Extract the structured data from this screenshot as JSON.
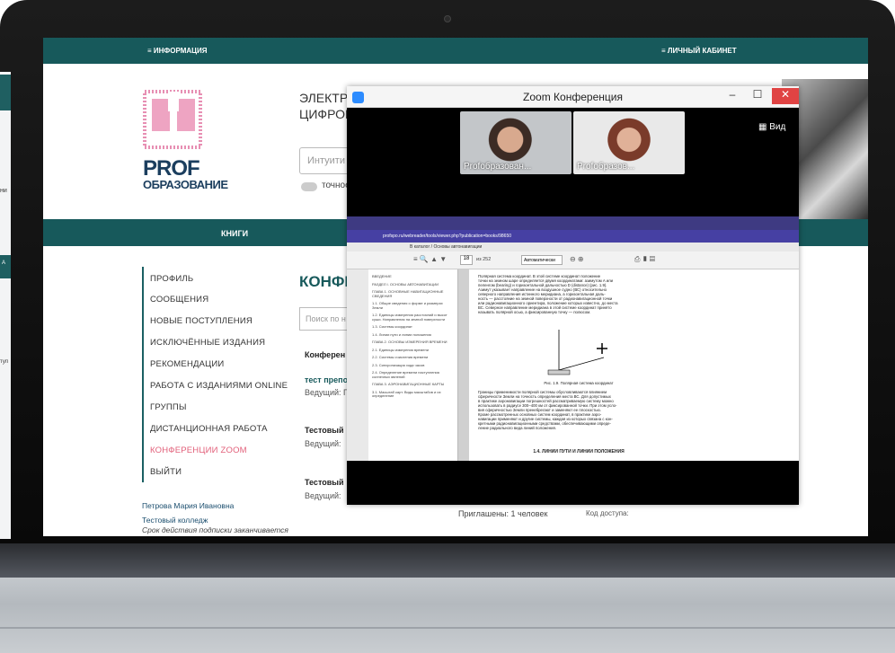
{
  "nav": {
    "left": "≡  ИНФОРМАЦИЯ",
    "right": "≡  ЛИЧНЫЙ КАБИНЕТ"
  },
  "logo": {
    "prof": "PROF",
    "obraz": "ОБРАЗОВАНИЕ"
  },
  "header": {
    "title_line1": "ЭЛЕКТРО",
    "title_line2": "ЦИФРОВ",
    "search_placeholder": "Интуити",
    "toggle_label": "точное"
  },
  "books_label": "КНИГИ",
  "menu": [
    "ПРОФИЛЬ",
    "СООБЩЕНИЯ",
    "НОВЫЕ ПОСТУПЛЕНИЯ",
    "ИСКЛЮЧЁННЫЕ ИЗДАНИЯ",
    "РЕКОМЕНДАЦИИ",
    "РАБОТА С ИЗДАНИЯМИ ONLINE",
    "ГРУППЫ",
    "ДИСТАНЦИОННАЯ РАБОТА",
    "КОНФЕРЕНЦИИ ZOOM",
    "ВЫЙТИ"
  ],
  "user": {
    "name": "Петрова Мария Ивановна",
    "college": "Тестовый колледж",
    "note": "Срок действия подписки заканчивается"
  },
  "conf": {
    "title": "КОНФЕ",
    "search_placeholder": "Поиск по н",
    "col_header": "Конферен",
    "rows": [
      {
        "title": "тест препо",
        "host": "Ведущий: Пе"
      },
      {
        "title": "Тестовый",
        "host": "Ведущий:"
      },
      {
        "title": "Тестовый",
        "host": "Ведущий:"
      }
    ],
    "invited": "Приглашены: 1 человек",
    "access": "Код доступа:"
  },
  "zoom": {
    "title": "Zoom Конференция",
    "participant1": "Profобразован...",
    "participant2": "Profобразов...",
    "view": "Вид",
    "pdf": {
      "page_num": "18",
      "page_total": "из 252",
      "zoom": "Автоматически",
      "breadcrumb": "В каталог / Основы автонавигации",
      "url": "profspo.ru/webreader/tools/viewer.php?publication=books/98650",
      "toc": [
        "ВВЕДЕНИЕ",
        "РАЗДЕЛ I. ОСНОВЫ АВТОНАВИГАЦИИ",
        "ГЛАВА 1. ОСНОВНЫЕ НАВИГАЦИОННЫЕ СВЕДЕНИЯ",
        "1.1. Общие сведения о форме и размерах Земли",
        "1.2. Единицы измерения расстояний и высот суши. Направления на земной поверхности",
        "1.3. Системы координат",
        "1.4. Линии пути и линии положения",
        "ГЛАВА 2. ОСНОВЫ ИЗМЕРЕНИЯ ВРЕМЕНИ",
        "2.1. Единицы измерения времени",
        "2.2. Системы счисления времени",
        "2.3. Синхронизация хода часов",
        "2.4. Определение времени наступления солнечных явлений",
        "ГЛАВА 3. АЭРОНАВИГАЦИОННЫЕ КАРТЫ",
        "3.1. Масштаб карт. Виды масштабов и их определение"
      ],
      "page_lines": [
        "Полярная система координат. В этой системе координат положение",
        "точки на земном шаре определяется двумя координатами: азимутом A или",
        "пеленгом (bearing) и горизонтальной дальностью D (distance) (рис. 1.9).",
        "Азимут указывает направление на воздушное судно (ВС) относительно",
        "северного направления истинного меридиана, а горизонтальная даль-",
        "ность — расстояние на земной поверхности от радионавигационной точки",
        "или радионавигационного ориентира, положение которых известно, до места",
        "ВС. Северное направление меридиана в этой системе координат принято",
        "называть полярной осью, а фиксированную точку — полюсом."
      ],
      "fig_caption": "Рис. 1.9. Полярная система координат",
      "page_lines2": [
        "Границы применимости полярной системы обусловливаются влиянием",
        "сферичности Земли на точность определения места ВС. Для допустимых",
        "в практике аэронавигации погрешностей рассматриваемую систему можно",
        "использовать в радиусе 300–400 км от фиксированной точки. При этом усло-",
        "вия сферичностью Земли пренебрегают и заменяют ее плоскостью.",
        "Кроме рассмотренных основных систем координат, в практике аэро-",
        "навигации применяют и другие системы, каждая из которых связана с кон-",
        "кретными радионавигационными средствами, обеспечивающими опреде-",
        "ление радиального вида линий положения."
      ],
      "section_title": "1.4. ЛИНИИ ПУТИ И ЛИНИИ ПОЛОЖЕНИЯ"
    }
  },
  "left_window": {
    "t1": "ни",
    "t2": "А",
    "t3": "туп"
  }
}
